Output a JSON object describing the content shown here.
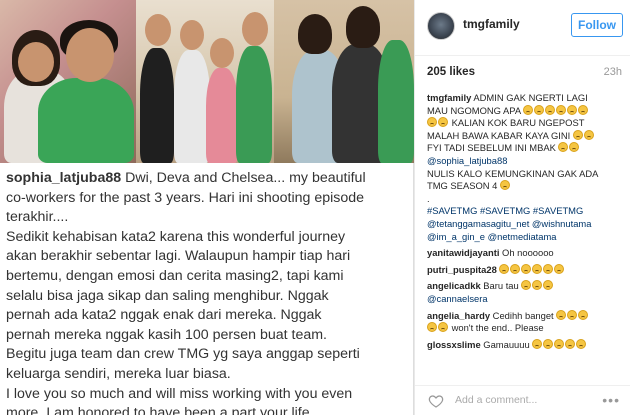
{
  "post": {
    "caption_user": "sophia_latjuba88",
    "caption_lines": [
      "Dwi, Deva and Chelsea... my beautiful",
      "co-workers for the past 3 years. Hari ini shooting episode",
      "terakhir....",
      "Sedikit kehabisan kata2 karena this wonderful journey",
      "akan berakhir sebentar lagi. Walaupun hampir tiap hari",
      "bertemu, dengan emosi dan cerita masing2, tapi kami",
      "selalu bisa jaga sikap dan saling menghibur. Nggak",
      "pernah ada kata2 nggak enak dari mereka. Nggak",
      "pernah mereka nggak kasih 100 persen buat team.",
      "Begitu juga team dan crew TMG yg saya anggap seperti",
      "keluarga sendiri, mereka luar biasa.",
      "I love you so much and will miss working with you even",
      "more. I am honored to have been a part your life."
    ]
  },
  "header": {
    "account": "tmgfamily",
    "follow_label": "Follow"
  },
  "stats": {
    "likes": "205 likes",
    "time_ago": "23h"
  },
  "comments": [
    {
      "user": "tmgfamily",
      "lines": [
        "ADMIN GAK NGERTI LAGI",
        "MAU NGOMONG APA",
        "",
        "KALIAN KOK BARU NGEPOST",
        "MALAH BAWA KABAR KAYA GINI",
        "FYI TADI SEBELUM INI MBAK",
        "@sophia_latjuba88",
        "NULIS KALO KEMUNGKINAN GAK ADA",
        "TMG SEASON 4",
        ".",
        "#SAVETMG #SAVETMG #SAVETMG",
        "@tetanggamasagitu_net @wishnutama",
        "@im_a_gin_e @netmediatama"
      ]
    },
    {
      "user": "yanitawidjayanti",
      "text": "Oh noooooo"
    },
    {
      "user": "putri_puspita28",
      "text": ""
    },
    {
      "user": "angelicadkk",
      "text": "Baru tau"
    },
    {
      "user": "",
      "text": "@cannaelsera"
    },
    {
      "user": "angelia_hardy",
      "text": "Cedihh banget"
    },
    {
      "user": "",
      "text": "won't the end.. Please"
    },
    {
      "user": "glossxslime",
      "text": "Gamauuuu"
    }
  ],
  "footer": {
    "add_comment_placeholder": "Add a comment...",
    "more_label": "•••"
  },
  "colors": {
    "accent": "#3897f0",
    "emoji": "#f5c542"
  }
}
